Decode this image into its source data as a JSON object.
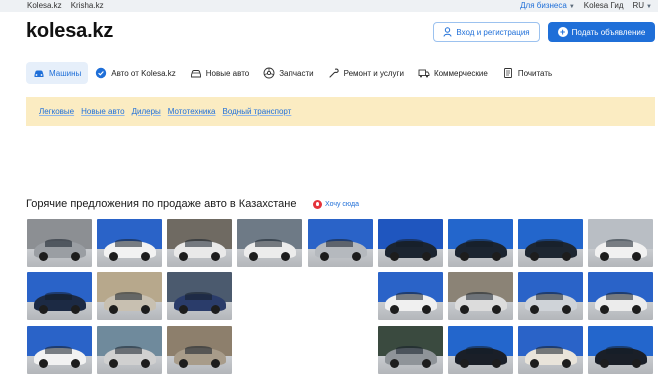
{
  "topbar": {
    "left_links": [
      "Kolesa.kz",
      "Krisha.kz"
    ],
    "business": "Для бизнеса",
    "guide": "Kolesa Гид",
    "lang": "RU"
  },
  "header": {
    "logo": "kolesa.kz",
    "login_label": "Вход и регистрация",
    "post_label": "Подать объявление"
  },
  "nav": [
    {
      "label": "Машины",
      "icon": "car-icon",
      "active": true
    },
    {
      "label": "Авто от Kolesa.kz",
      "icon": "verified-badge-icon",
      "active": false
    },
    {
      "label": "Новые авто",
      "icon": "new-car-icon",
      "active": false
    },
    {
      "label": "Запчасти",
      "icon": "wheel-icon",
      "active": false
    },
    {
      "label": "Ремонт и услуги",
      "icon": "wrench-icon",
      "active": false
    },
    {
      "label": "Коммерческие",
      "icon": "truck-icon",
      "active": false
    },
    {
      "label": "Почитать",
      "icon": "document-icon",
      "active": false
    }
  ],
  "subnav": [
    "Легковые",
    "Новые авто",
    "Дилеры",
    "Мототехника",
    "Водный транспорт"
  ],
  "hot": {
    "title": "Горячие предложения по продаже авто в Казахстане",
    "want_label": "Хочу сюда"
  },
  "colors": {
    "accent": "#1f6fd8",
    "banner": "#fbecc2"
  },
  "thumbnails": [
    {
      "bg": "#8c8f93",
      "car": "#9a9ea3"
    },
    {
      "bg": "#2a63c8",
      "car": "#f2f2f2"
    },
    {
      "bg": "#6f6a62",
      "car": "#e9e9e9"
    },
    {
      "bg": "#6e7a86",
      "car": "#ececec"
    },
    {
      "bg": "#2a63c8",
      "car": "#b5b9be"
    },
    {
      "bg": "#1f56bf",
      "car": "#1b2430"
    },
    {
      "bg": "#2366cc",
      "car": "#1b2430"
    },
    {
      "bg": "#2366cc",
      "car": "#1d2631"
    },
    {
      "bg": "#b9bec4",
      "car": "#f1f1f1"
    },
    {
      "bg": "#2a63c8",
      "car": "#1c2a44"
    },
    {
      "bg": "#b7a88c",
      "car": "#c8c0b1"
    },
    {
      "bg": "#4b5a6e",
      "car": "#2a3c6a"
    },
    {
      "bg": "#2a63c8",
      "car": "#f0f0f0"
    },
    {
      "bg": "#8b8376",
      "car": "#dcdcdc"
    },
    {
      "bg": "#2a63c8",
      "car": "#cfd3d8"
    },
    {
      "bg": "#2a63c8",
      "car": "#ececec"
    },
    {
      "bg": "#2a63c8",
      "car": "#f2f2f2"
    },
    {
      "bg": "#6f8a9c",
      "car": "#d0d0d0"
    },
    {
      "bg": "#8d7f6c",
      "car": "#a89c8a"
    },
    {
      "bg": "#3a4a3f",
      "car": "#8f9499"
    },
    {
      "bg": "#2366cc",
      "car": "#1a1f28"
    },
    {
      "bg": "#2a63c8",
      "car": "#e9e4da"
    },
    {
      "bg": "#2366cc",
      "car": "#1a1f28"
    },
    {
      "bg": "#2a63c8",
      "car": "#2a1f1f"
    }
  ]
}
